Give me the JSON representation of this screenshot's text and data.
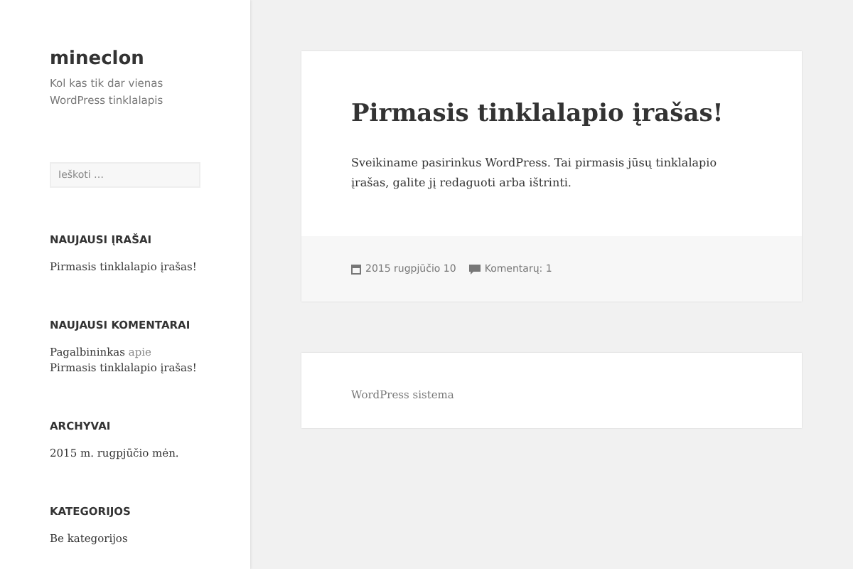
{
  "site": {
    "title": "mineclon",
    "description": "Kol kas tik dar vienas WordPress tinklalapis"
  },
  "search": {
    "placeholder": "Ieškoti …"
  },
  "widgets": [
    {
      "kind": "links",
      "title": "NAUJAUSI ĮRAŠAI",
      "items": [
        "Pirmasis tinklalapio įrašas!"
      ]
    },
    {
      "kind": "comments",
      "title": "NAUJAUSI KOMENTARAI",
      "comments": [
        {
          "author": "Pagalbininkas",
          "connector": "apie",
          "post": "Pirmasis tinklalapio įrašas!"
        }
      ]
    },
    {
      "kind": "links",
      "title": "ARCHYVAI",
      "items": [
        "2015 m. rugpjūčio mėn."
      ]
    },
    {
      "kind": "links",
      "title": "KATEGORIJOS",
      "items": [
        "Be kategorijos"
      ]
    }
  ],
  "post": {
    "title": "Pirmasis tinklalapio įrašas!",
    "body": "Sveikiname pasirinkus WordPress. Tai pirmasis jūsų tinklalapio įrašas, galite jį redaguoti arba ištrinti.",
    "date": "2015 rugpjūčio 10",
    "comments": "Komentarų: 1"
  },
  "footer": {
    "credit": "WordPress sistema"
  }
}
